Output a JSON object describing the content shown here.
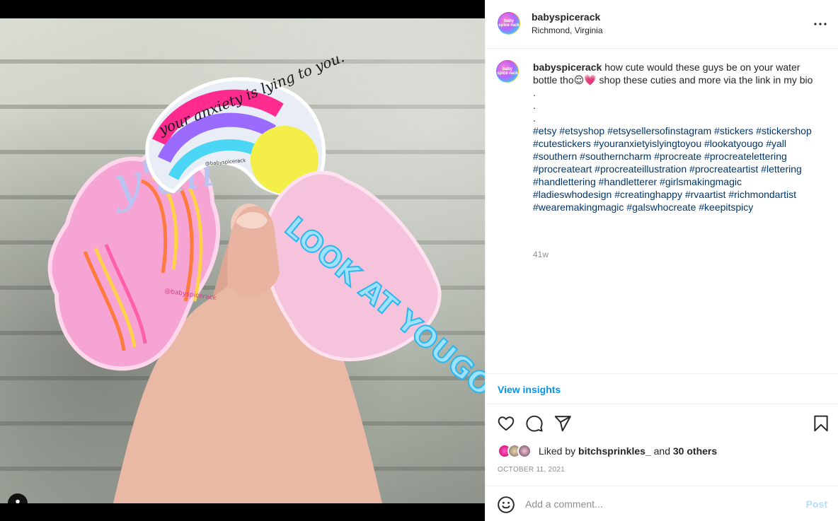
{
  "post": {
    "username": "babyspicerack",
    "location": "Richmond, Virginia",
    "avatar_text": "baby spice rack",
    "more_icon": "more-horizontal-icon"
  },
  "media": {
    "sticker_top_text": "your anxiety is lying to you.",
    "sticker_left_text": "y'all",
    "sticker_right_text": "LOOK AT YOUGO",
    "sticker_left_watermark": "@babyspicerack",
    "sticker_top_watermark": "@babyspicerack",
    "user_tag_icon": "user-tag-icon"
  },
  "caption": {
    "username": "babyspicerack",
    "text": "how cute would these guys be on your water bottle tho😌💗 shop these cuties and more via the link in my bio",
    "dots": [
      ".",
      ".",
      "."
    ],
    "hashtags": [
      "#etsy",
      "#etsyshop",
      "#etsysellersofinstagram",
      "#stickers",
      "#stickershop",
      "#cutestickers",
      "#youranxietyislyingtoyou",
      "#lookatyougo",
      "#yall",
      "#southern",
      "#southerncharm",
      "#procreate",
      "#procreatelettering",
      "#procreateart",
      "#procreateillustration",
      "#procreateartist",
      "#lettering",
      "#handlettering",
      "#handletterer",
      "#girlsmakingmagic",
      "#ladieswhodesign",
      "#creatinghappy",
      "#rvaartist",
      "#richmondartist",
      "#wearemakingmagic",
      "#galswhocreate",
      "#keepitspicy"
    ],
    "age": "41w"
  },
  "insights": {
    "label": "View insights"
  },
  "actions": {
    "like_icon": "heart-icon",
    "comment_icon": "comment-icon",
    "share_icon": "share-icon",
    "save_icon": "bookmark-icon"
  },
  "likes": {
    "prefix": "Liked by",
    "user": "bitchsprinkles_",
    "joiner": "and",
    "others": "30 others"
  },
  "date": "OCTOBER 11, 2021",
  "comment": {
    "placeholder": "Add a comment...",
    "post_label": "Post",
    "emoji_icon": "emoji-icon"
  },
  "colors": {
    "link": "#00376b",
    "accent": "#0095f6",
    "post_disabled": "#b2dffc",
    "muted": "#8e8e8e"
  }
}
